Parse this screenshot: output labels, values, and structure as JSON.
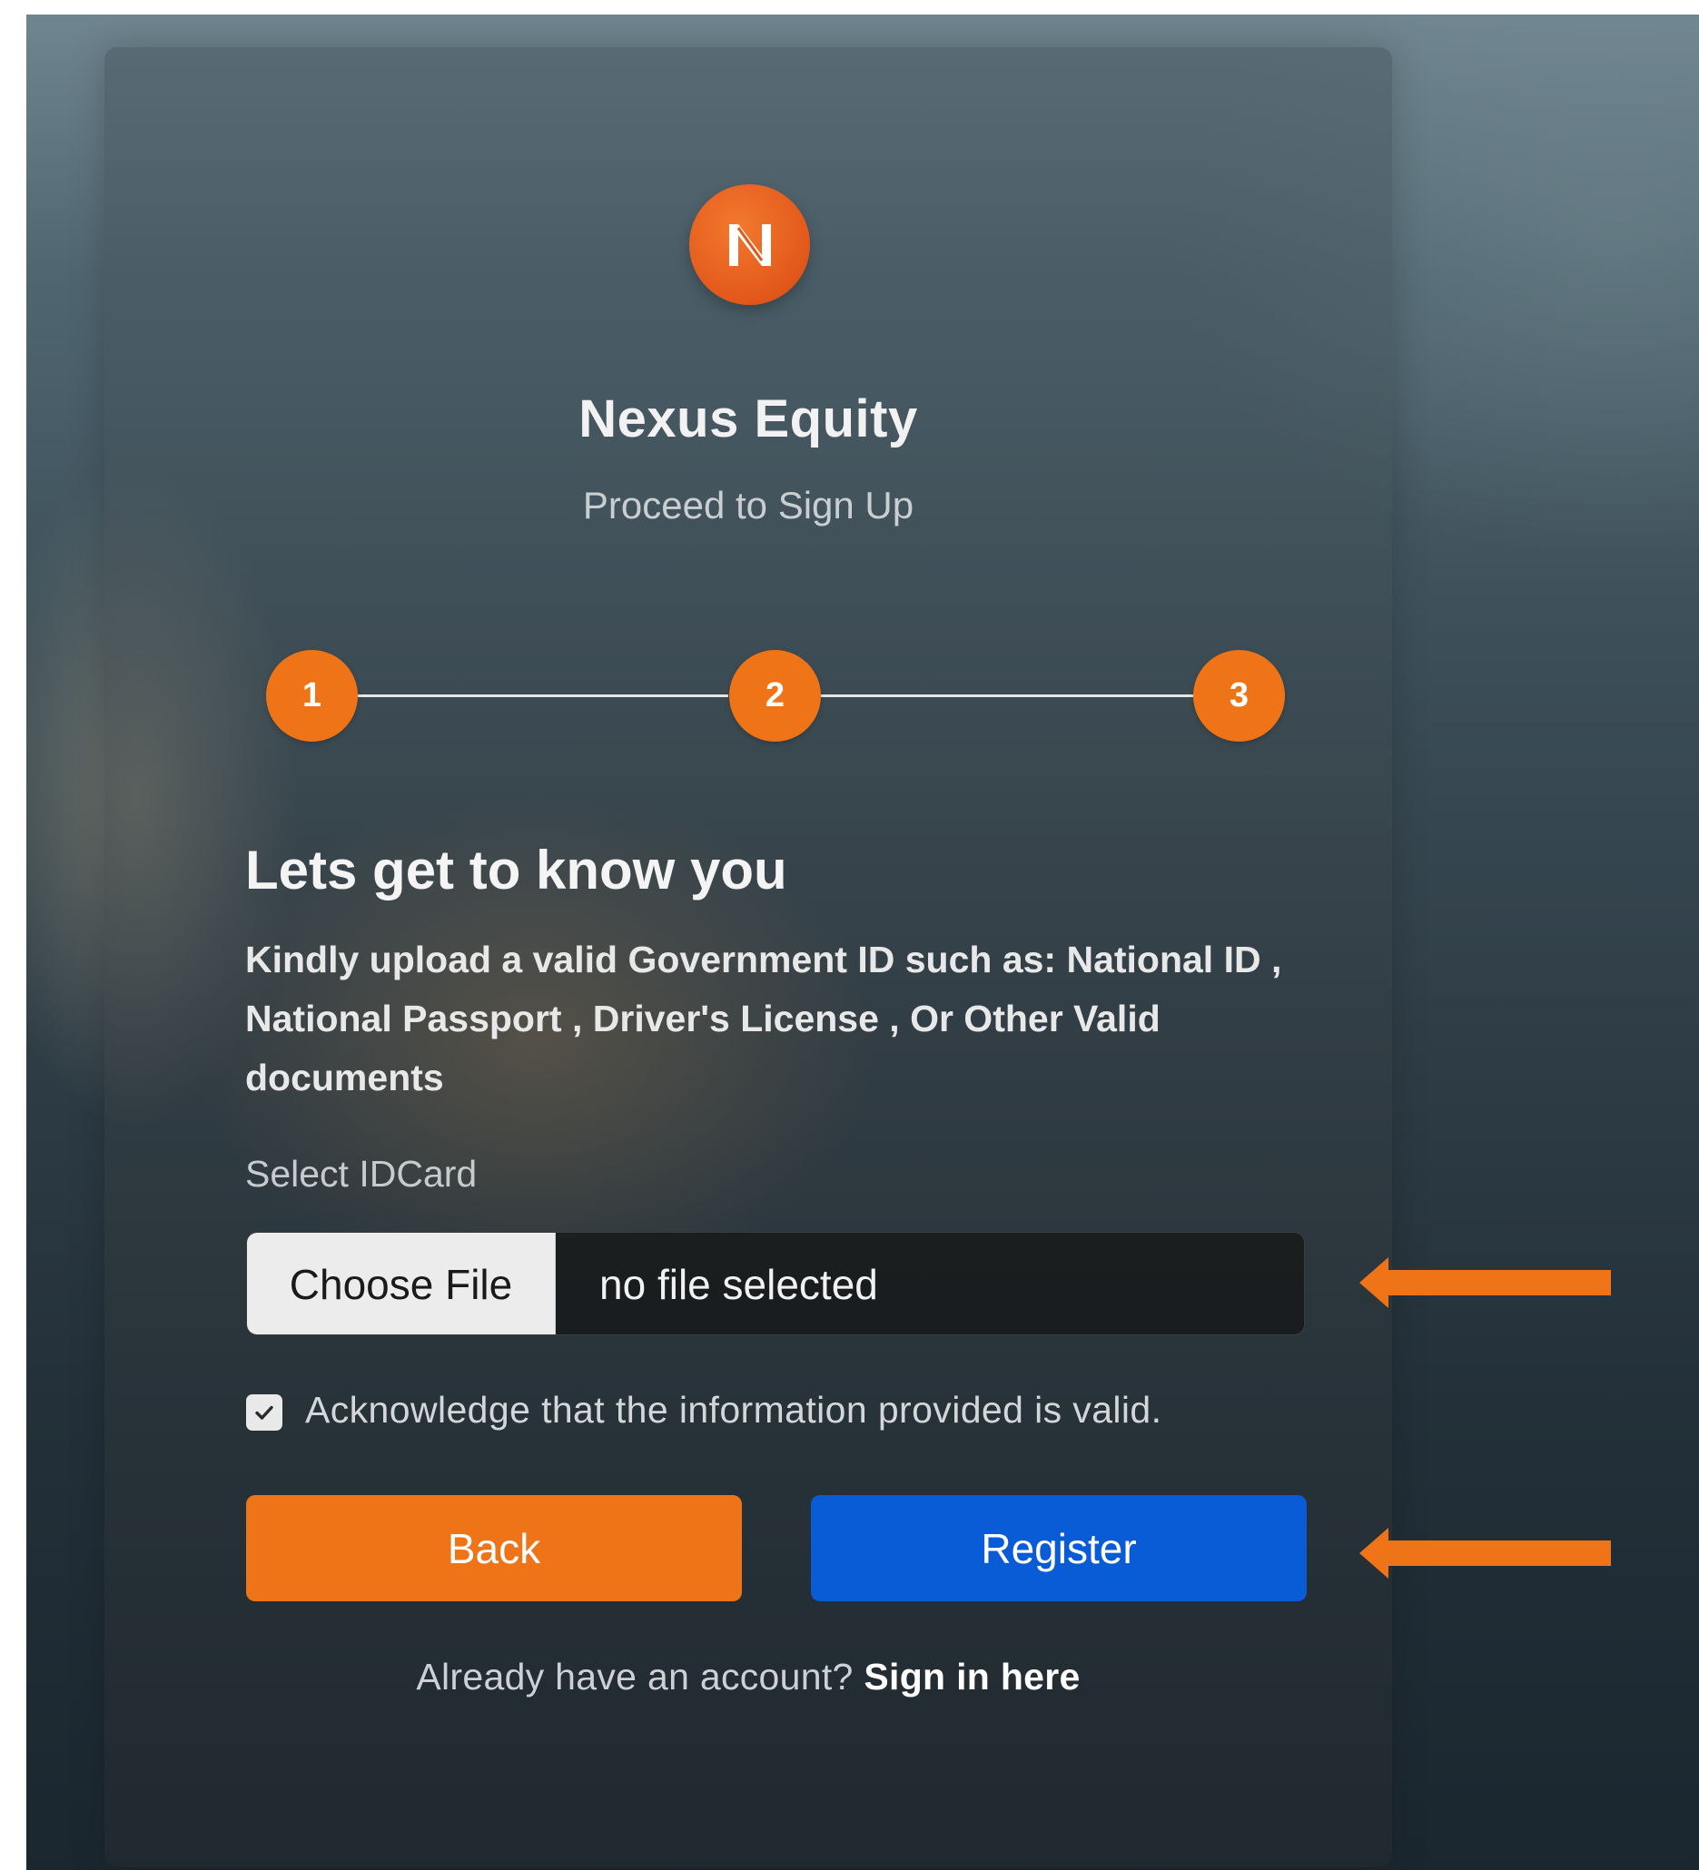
{
  "brand": {
    "logo_letter": "N",
    "name": "Nexus Equity",
    "subtitle": "Proceed to Sign Up"
  },
  "stepper": {
    "steps": [
      "1",
      "2",
      "3"
    ]
  },
  "form": {
    "heading": "Lets get to know you",
    "instructions": "Kindly upload a valid Government ID such as: National ID , National Passport , Driver's License , Or Other Valid documents",
    "id_label": "Select IDCard",
    "file_button": "Choose File",
    "file_status": "no file selected",
    "acknowledge_checked": true,
    "acknowledge_text": "Acknowledge that the information provided is valid.",
    "back_label": "Back",
    "register_label": "Register",
    "signin_prompt": "Already have an account?",
    "signin_link": "Sign in here"
  },
  "colors": {
    "accent_orange": "#ef7418",
    "primary_blue": "#0a5bd6",
    "annotation_arrow": "#ef7418"
  },
  "icons": {
    "logo": "n-logo-icon",
    "checkbox": "checkmark-icon",
    "annotations": "arrow-left-icon"
  }
}
